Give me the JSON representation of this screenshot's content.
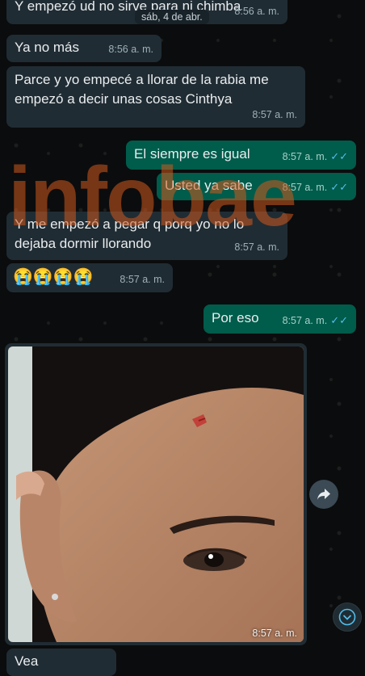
{
  "date_chip": "sáb, 4 de abr.",
  "messages": [
    {
      "text": "Y empezó ud no sirve para ni chimba",
      "time": "8:56 a. m."
    },
    {
      "text": "Ya no más",
      "time": "8:56 a. m."
    },
    {
      "text": "Parce y yo empecé a llorar de la rabia me empezó a decir unas cosas Cinthya",
      "time": "8:57 a. m."
    },
    {
      "text": "El siempre es igual",
      "time": "8:57 a. m."
    },
    {
      "text": "Usted ya sabe",
      "time": "8:57 a. m."
    },
    {
      "text": "Y me empezó a pegar q porq yo no lo dejaba dormir llorando",
      "time": "8:57 a. m."
    },
    {
      "text": "😭😭😭😭",
      "time": "8:57 a. m."
    },
    {
      "text": "Por eso",
      "time": "8:57 a. m."
    },
    {
      "text": "Vea",
      "time": ""
    }
  ],
  "photo": {
    "time": "8:57 a. m.",
    "icon": "photo-image-icon"
  },
  "watermark": "infobae",
  "colors": {
    "incoming": "#202c33",
    "outgoing": "#005c4b",
    "read_ticks": "#53bdeb"
  }
}
